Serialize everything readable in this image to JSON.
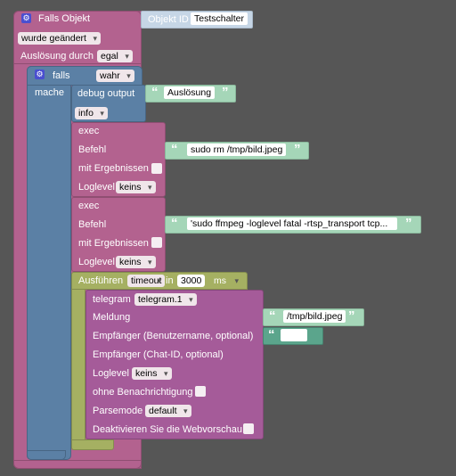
{
  "event_block": {
    "title": "Falls Objekt",
    "object_id_label": "Objekt ID",
    "object_id_value": "Testschalter",
    "change_option": "wurde geändert",
    "trigger_label": "Auslösung durch",
    "trigger_value": "egal"
  },
  "if_block": {
    "if_label": "falls",
    "condition": "wahr",
    "do_label": "mache"
  },
  "debug_block": {
    "label": "debug output",
    "text": "Auslösung",
    "level": "info"
  },
  "exec1": {
    "title": "exec",
    "command_label": "Befehl",
    "command": "sudo rm /tmp/bild.jpeg",
    "with_results_label": "mit Ergebnissen",
    "loglevel_label": "Loglevel",
    "loglevel_value": "keins"
  },
  "exec2": {
    "title": "exec",
    "command_label": "Befehl",
    "command": "'sudo ffmpeg -loglevel fatal -rtsp_transport tcp...",
    "with_results_label": "mit Ergebnissen",
    "loglevel_label": "Loglevel",
    "loglevel_value": "keins"
  },
  "timeout_block": {
    "run_label": "Ausführen",
    "type": "timeout",
    "in_label": "in",
    "delay": "3000",
    "unit": "ms"
  },
  "telegram_block": {
    "title": "telegram",
    "instance": "telegram.1",
    "message_label": "Meldung",
    "message": "/tmp/bild.jpeg",
    "recipient_label": "Empfänger (Benutzername, optional)",
    "recipient_value": "",
    "chat_id_label": "Empfänger (Chat-ID, optional)",
    "loglevel_label": "Loglevel",
    "loglevel_value": "keins",
    "silent_label": "ohne Benachrichtigung",
    "parsemode_label": "Parsemode",
    "parsemode_value": "default",
    "disable_preview_label": "Deaktivieren Sie die Webvorschau"
  },
  "colors": {
    "workspace": "#565656",
    "event": "#b3628f",
    "logic": "#5b80a5",
    "timeout": "#a5b062",
    "telegram": "#a55b99",
    "text": "#5ba58c"
  }
}
